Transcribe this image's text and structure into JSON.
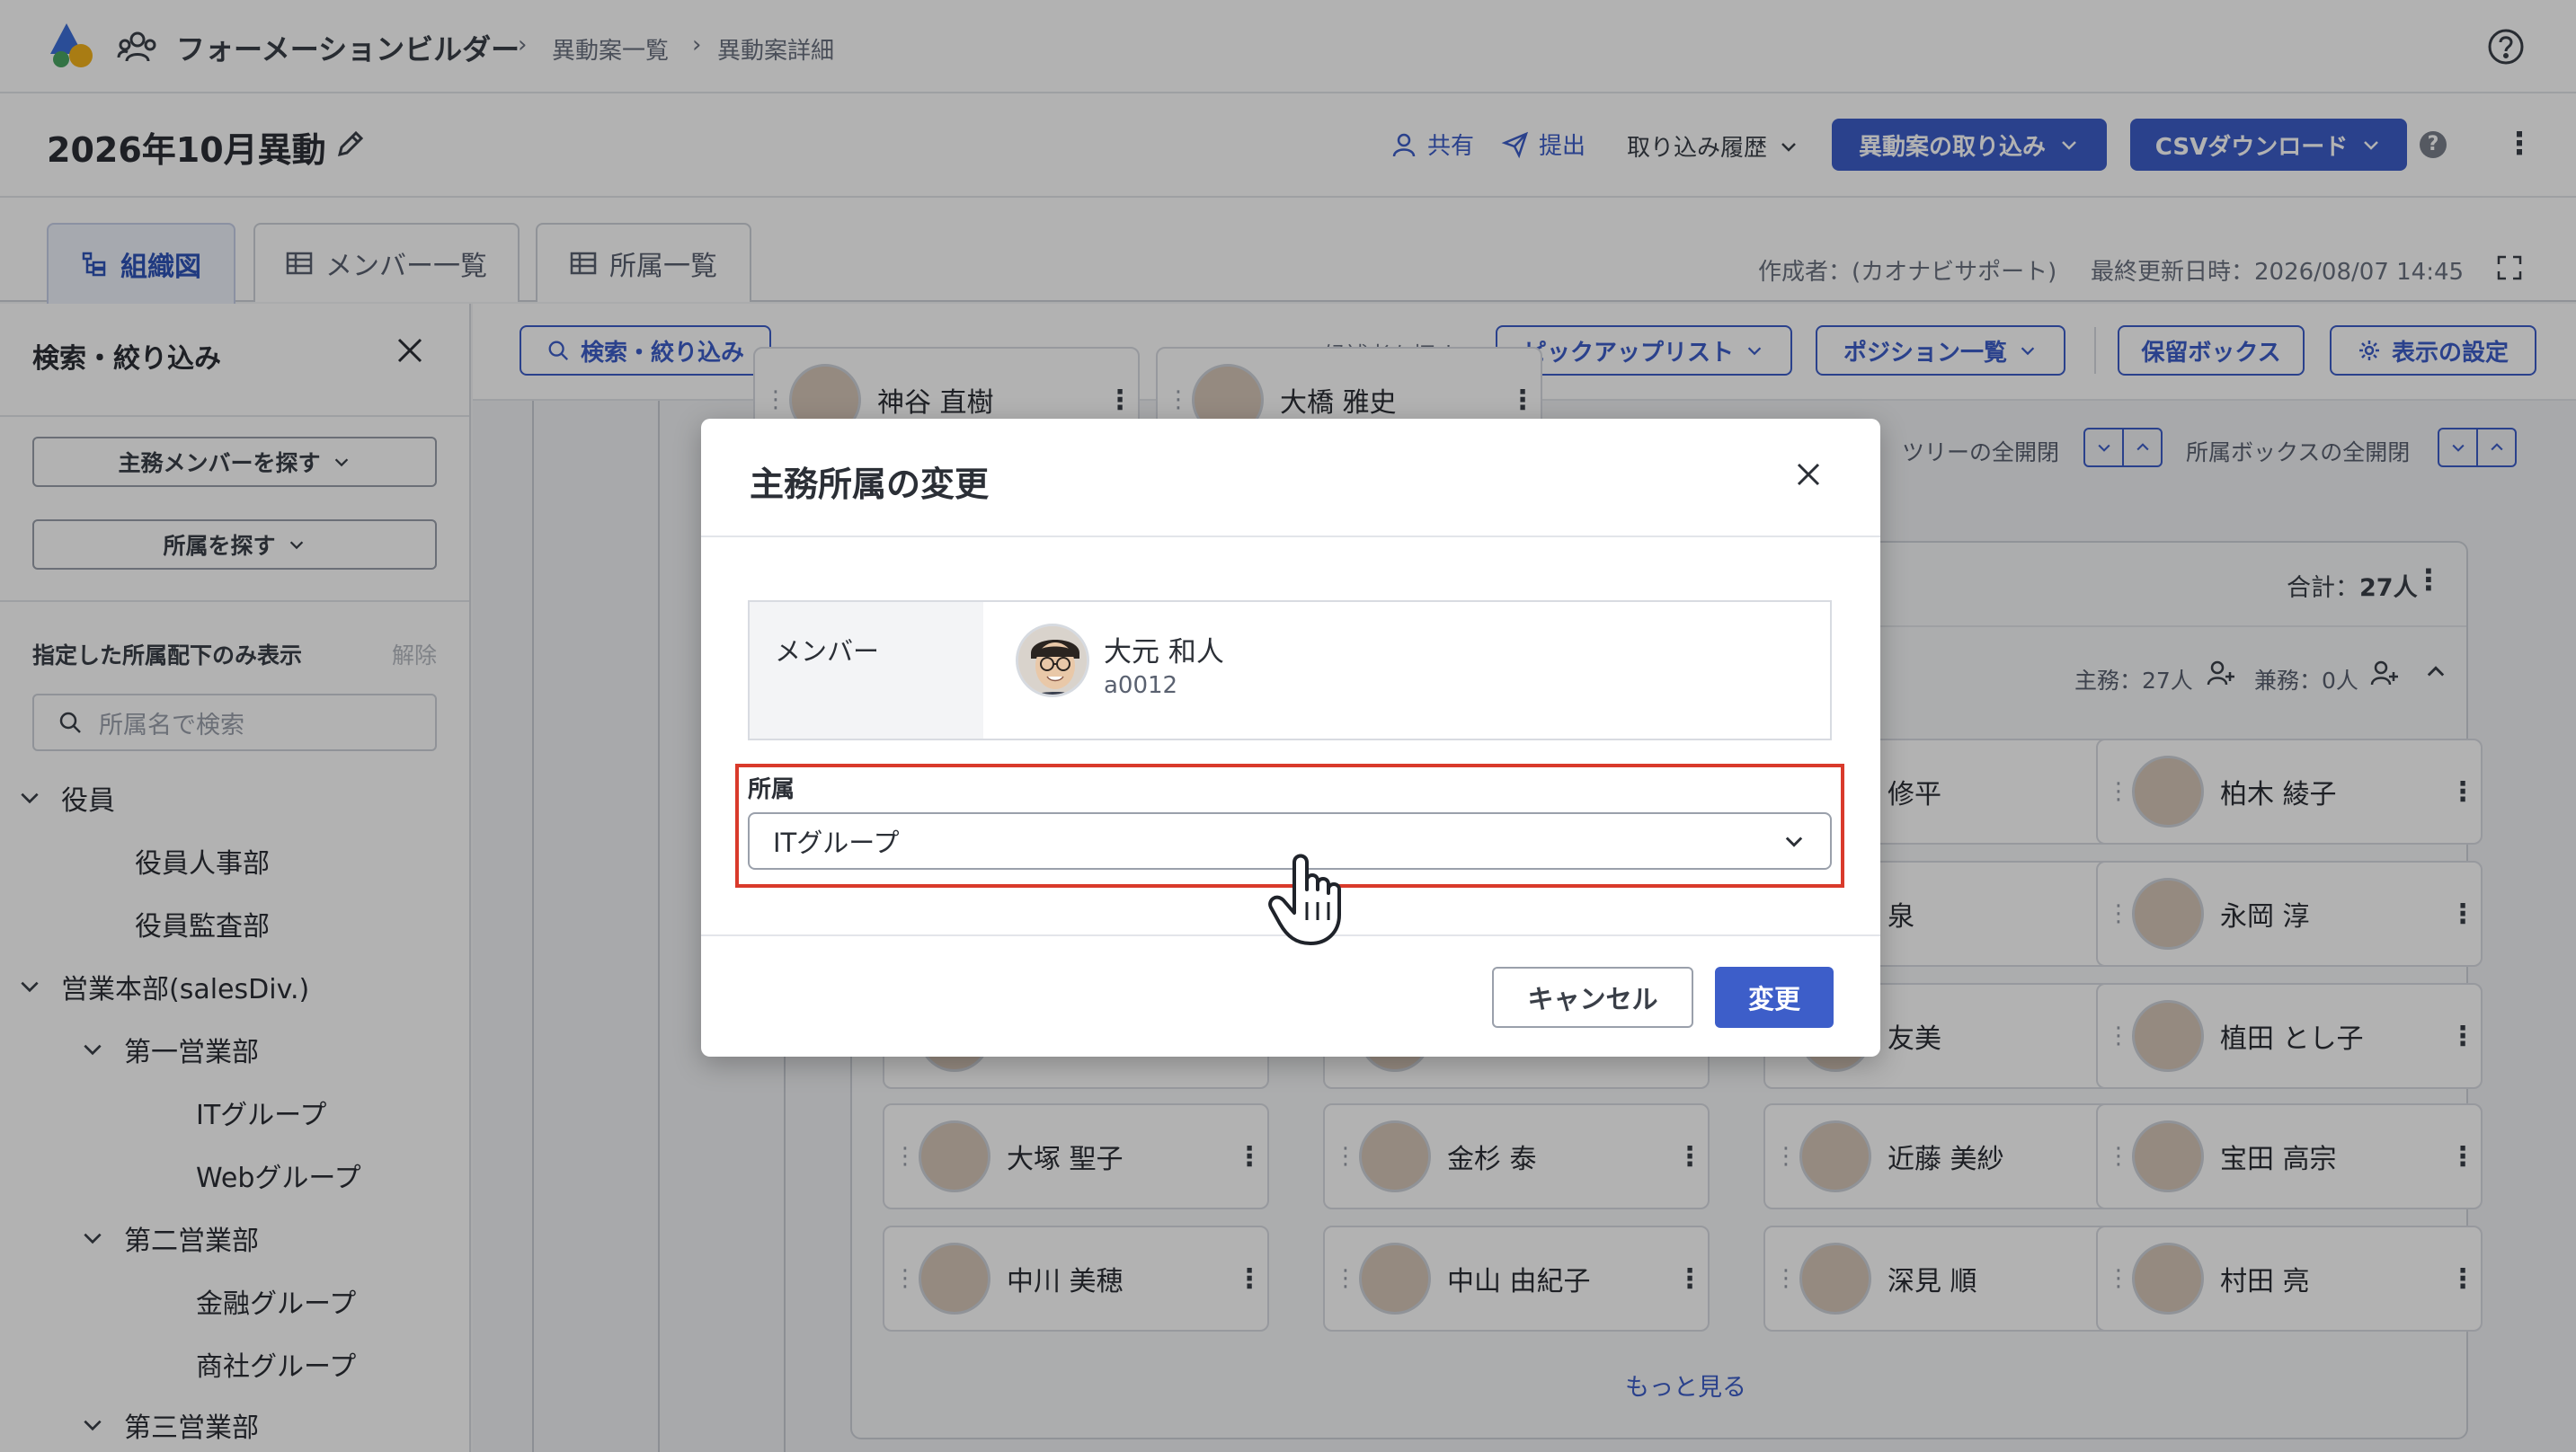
{
  "header": {
    "app_name": "フォーメーションビルダー",
    "breadcrumb": [
      "異動案一覧",
      "異動案詳細"
    ],
    "help_icon": "question-circle-icon"
  },
  "title_bar": {
    "title": "2026年10月異動",
    "share_label": "共有",
    "submit_label": "提出",
    "import_history_label": "取り込み履歴",
    "import_label": "異動案の取り込み",
    "csv_label": "CSVダウンロード"
  },
  "tabs": [
    {
      "label": "組織図",
      "active": true
    },
    {
      "label": "メンバー一覧",
      "active": false
    },
    {
      "label": "所属一覧",
      "active": false
    }
  ],
  "meta": {
    "author": "作成者：(カオナビサポート)",
    "updated": "最終更新日時：2026/08/07 14:45"
  },
  "sidebar": {
    "title": "検索・絞り込み",
    "find_member": "主務メンバーを探す",
    "find_dept": "所属を探す",
    "filter_label": "指定した所属配下のみ表示",
    "clear_label": "解除",
    "search_placeholder": "所属名で検索",
    "tree": [
      {
        "label": "役員",
        "level": 0,
        "expanded": true
      },
      {
        "label": "役員人事部",
        "level": 1
      },
      {
        "label": "役員監査部",
        "level": 1
      },
      {
        "label": "営業本部(salesDiv.)",
        "level": 0,
        "expanded": true
      },
      {
        "label": "第一営業部",
        "level": 1,
        "expanded": true
      },
      {
        "label": "ITグループ",
        "level": 2
      },
      {
        "label": "Webグループ",
        "level": 2
      },
      {
        "label": "第二営業部",
        "level": 1,
        "expanded": true
      },
      {
        "label": "金融グループ",
        "level": 2
      },
      {
        "label": "商社グループ",
        "level": 2
      },
      {
        "label": "第三営業部",
        "level": 1,
        "expanded": true
      }
    ]
  },
  "toolbar": {
    "search_filter": "検索・絞り込み",
    "candidate_label": "候補者を探す：",
    "pick_list": "ピックアップリスト",
    "position_list": "ポジション一覧",
    "hold_box": "保留ボックス",
    "display_settings": "表示の設定"
  },
  "canvas": {
    "tree_toggle": "ツリーの全開閉",
    "box_toggle": "所属ボックスの全開閉",
    "total": "合計：",
    "total_count": "27人",
    "main_count": "主務：27人",
    "sub_count": "兼務：0人",
    "partial_top": [
      "神谷 直樹",
      "大橋 雅史"
    ],
    "partial_right": [
      "修平",
      "泉",
      "友美"
    ],
    "cards_right": [
      "柏木 綾子",
      "永岡 淳",
      "植田 とし子"
    ],
    "cards_row4": [
      "大塚 聖子",
      "金杉 泰",
      "近藤 美紗",
      "宝田 高宗"
    ],
    "cards_row5": [
      "中川 美穂",
      "中山 由紀子",
      "深見 順",
      "村田 亮"
    ],
    "more_label": "もっと見る"
  },
  "modal": {
    "title": "主務所属の変更",
    "member_label": "メンバー",
    "member_name": "大元 和人",
    "member_id": "a0012",
    "dept_label": "所属",
    "dept_value": "ITグループ",
    "cancel_label": "キャンセル",
    "change_label": "変更"
  },
  "colors": {
    "primary": "#3d5ec9",
    "highlight_border": "#d93a2b"
  }
}
